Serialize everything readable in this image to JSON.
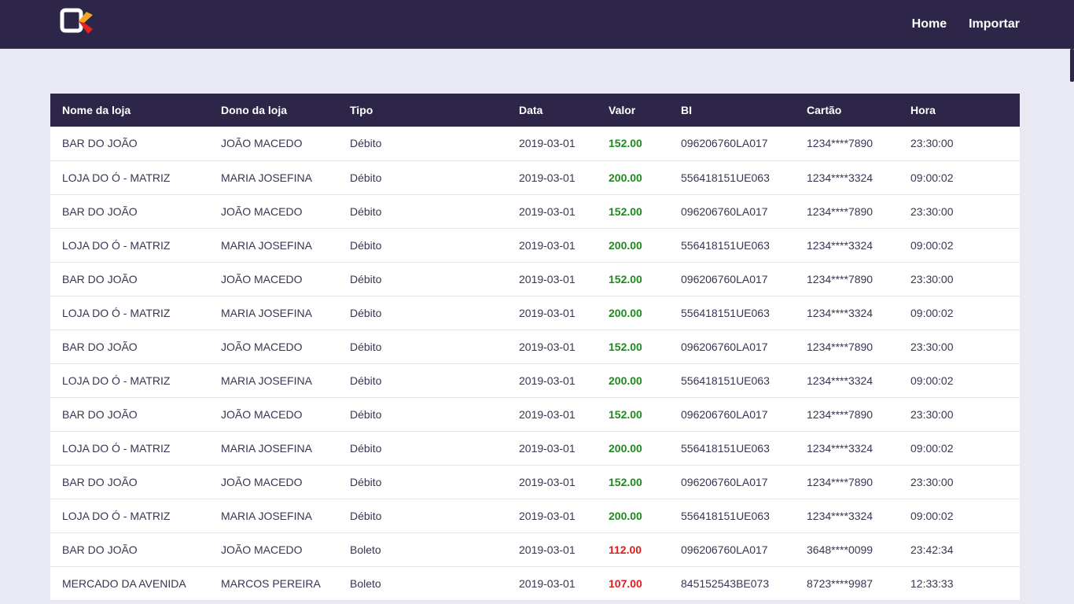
{
  "nav": {
    "home": "Home",
    "import": "Importar"
  },
  "colors": {
    "navbar_bg": "#2d2649",
    "page_bg": "#e9e9f3",
    "positive_value": "#1e8a1e",
    "negative_value": "#e01b1b",
    "logo_orange": "#f5a623",
    "logo_red": "#e8231f"
  },
  "table": {
    "headers": [
      "Nome da loja",
      "Dono da loja",
      "Tipo",
      "Data",
      "Valor",
      "BI",
      "Cartão",
      "Hora"
    ],
    "rows": [
      {
        "store": "BAR DO JOÃO",
        "owner": "JOÃO MACEDO",
        "type": "Débito",
        "date": "2019-03-01",
        "value": "152.00",
        "value_status": "positive",
        "bi": "096206760LA017",
        "card": "1234****7890",
        "time": "23:30:00"
      },
      {
        "store": "LOJA DO Ó - MATRIZ",
        "owner": "MARIA JOSEFINA",
        "type": "Débito",
        "date": "2019-03-01",
        "value": "200.00",
        "value_status": "positive",
        "bi": "556418151UE063",
        "card": "1234****3324",
        "time": "09:00:02"
      },
      {
        "store": "BAR DO JOÃO",
        "owner": "JOÃO MACEDO",
        "type": "Débito",
        "date": "2019-03-01",
        "value": "152.00",
        "value_status": "positive",
        "bi": "096206760LA017",
        "card": "1234****7890",
        "time": "23:30:00"
      },
      {
        "store": "LOJA DO Ó - MATRIZ",
        "owner": "MARIA JOSEFINA",
        "type": "Débito",
        "date": "2019-03-01",
        "value": "200.00",
        "value_status": "positive",
        "bi": "556418151UE063",
        "card": "1234****3324",
        "time": "09:00:02"
      },
      {
        "store": "BAR DO JOÃO",
        "owner": "JOÃO MACEDO",
        "type": "Débito",
        "date": "2019-03-01",
        "value": "152.00",
        "value_status": "positive",
        "bi": "096206760LA017",
        "card": "1234****7890",
        "time": "23:30:00"
      },
      {
        "store": "LOJA DO Ó - MATRIZ",
        "owner": "MARIA JOSEFINA",
        "type": "Débito",
        "date": "2019-03-01",
        "value": "200.00",
        "value_status": "positive",
        "bi": "556418151UE063",
        "card": "1234****3324",
        "time": "09:00:02"
      },
      {
        "store": "BAR DO JOÃO",
        "owner": "JOÃO MACEDO",
        "type": "Débito",
        "date": "2019-03-01",
        "value": "152.00",
        "value_status": "positive",
        "bi": "096206760LA017",
        "card": "1234****7890",
        "time": "23:30:00"
      },
      {
        "store": "LOJA DO Ó - MATRIZ",
        "owner": "MARIA JOSEFINA",
        "type": "Débito",
        "date": "2019-03-01",
        "value": "200.00",
        "value_status": "positive",
        "bi": "556418151UE063",
        "card": "1234****3324",
        "time": "09:00:02"
      },
      {
        "store": "BAR DO JOÃO",
        "owner": "JOÃO MACEDO",
        "type": "Débito",
        "date": "2019-03-01",
        "value": "152.00",
        "value_status": "positive",
        "bi": "096206760LA017",
        "card": "1234****7890",
        "time": "23:30:00"
      },
      {
        "store": "LOJA DO Ó - MATRIZ",
        "owner": "MARIA JOSEFINA",
        "type": "Débito",
        "date": "2019-03-01",
        "value": "200.00",
        "value_status": "positive",
        "bi": "556418151UE063",
        "card": "1234****3324",
        "time": "09:00:02"
      },
      {
        "store": "BAR DO JOÃO",
        "owner": "JOÃO MACEDO",
        "type": "Débito",
        "date": "2019-03-01",
        "value": "152.00",
        "value_status": "positive",
        "bi": "096206760LA017",
        "card": "1234****7890",
        "time": "23:30:00"
      },
      {
        "store": "LOJA DO Ó - MATRIZ",
        "owner": "MARIA JOSEFINA",
        "type": "Débito",
        "date": "2019-03-01",
        "value": "200.00",
        "value_status": "positive",
        "bi": "556418151UE063",
        "card": "1234****3324",
        "time": "09:00:02"
      },
      {
        "store": "BAR DO JOÃO",
        "owner": "JOÃO MACEDO",
        "type": "Boleto",
        "date": "2019-03-01",
        "value": "112.00",
        "value_status": "negative",
        "bi": "096206760LA017",
        "card": "3648****0099",
        "time": "23:42:34"
      },
      {
        "store": "MERCADO DA AVENIDA",
        "owner": "MARCOS PEREIRA",
        "type": "Boleto",
        "date": "2019-03-01",
        "value": "107.00",
        "value_status": "negative",
        "bi": "845152543BE073",
        "card": "8723****9987",
        "time": "12:33:33"
      }
    ]
  }
}
